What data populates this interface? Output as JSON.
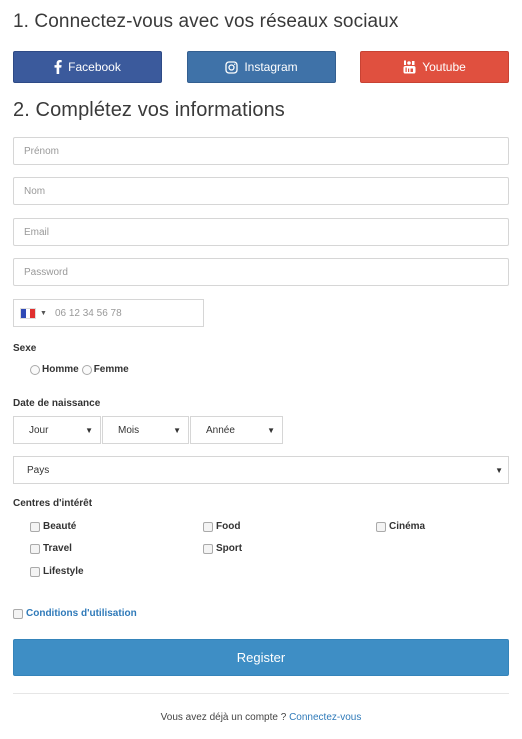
{
  "headings": {
    "social": "1. Connectez-vous avec vos réseaux sociaux",
    "info": "2. Complétez vos informations"
  },
  "social": {
    "facebook": "Facebook",
    "instagram": "Instagram",
    "youtube": "Youtube"
  },
  "fields": {
    "prenom": "Prénom",
    "nom": "Nom",
    "email": "Email",
    "password": "Password",
    "phone": "06 12 34 56 78"
  },
  "sexe": {
    "label": "Sexe",
    "options": [
      "Homme",
      "Femme"
    ]
  },
  "dob": {
    "label": "Date de naissance",
    "jour": "Jour",
    "mois": "Mois",
    "annee": "Année"
  },
  "pays": "Pays",
  "interests": {
    "label": "Centres d'intérêt",
    "items": [
      "Beauté",
      "Food",
      "Cinéma",
      "Travel",
      "Sport",
      "Lifestyle"
    ]
  },
  "terms": "Conditions d'utilisation",
  "register": "Register",
  "footer": {
    "text": "Vous avez déjà un compte ?",
    "link": "Connectez-vous"
  },
  "colors": {
    "facebook": "#3b5a9c",
    "instagram": "#3f72a8",
    "youtube": "#e0503f",
    "primary": "#3e8ec5",
    "link": "#2f7ab9"
  }
}
